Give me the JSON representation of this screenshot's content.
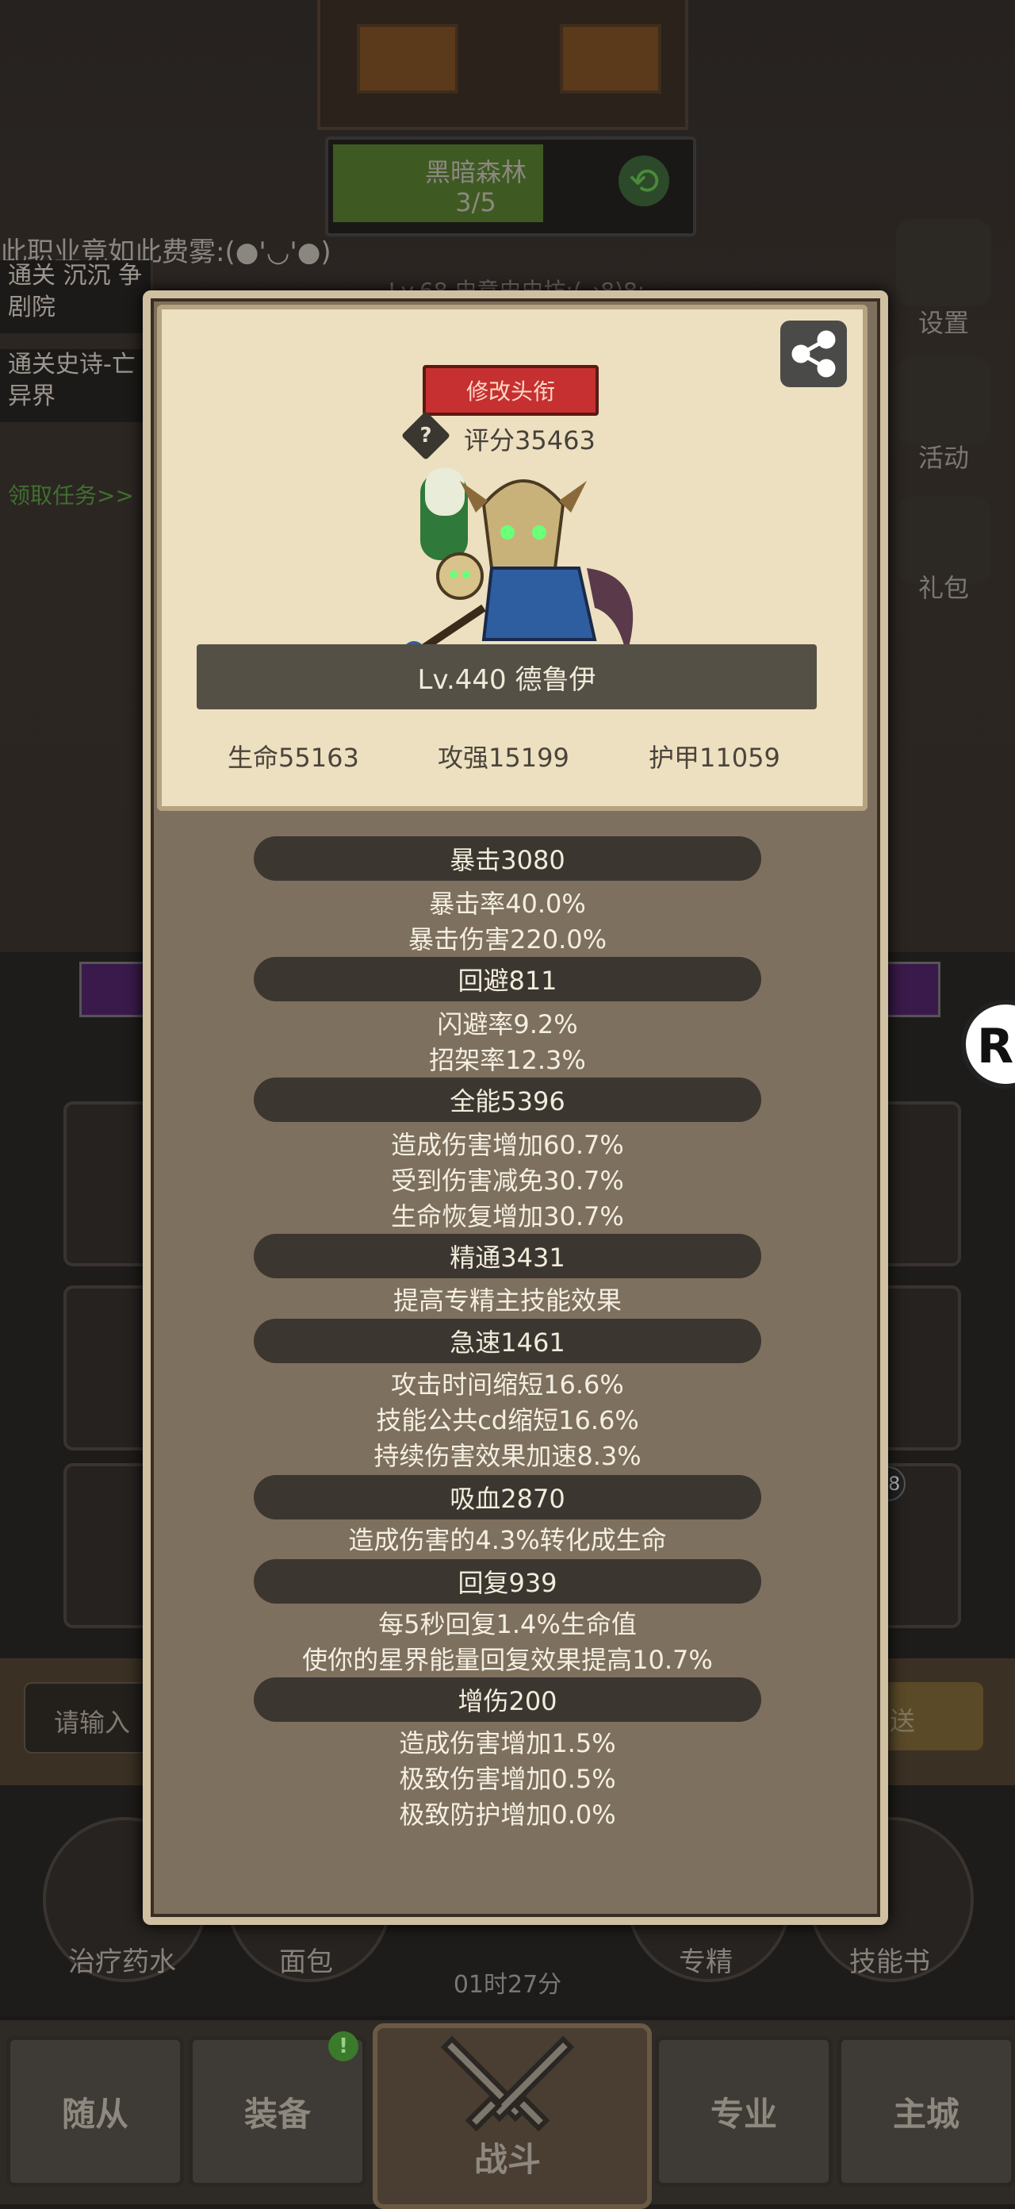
{
  "background": {
    "map": {
      "name": "黑暗森林",
      "progress": "3/5",
      "progress_fraction": 0.6
    },
    "note": "此职业竟如此费雾:(●'◡'●)",
    "level_note": "Lv.68 史意史史坊:(→8)8;",
    "quests": [
      "通关 沉沉 争剧院",
      "通关史诗-亡 异界"
    ],
    "quest_task": "领取任务>>",
    "side_menu": [
      {
        "label": "设置",
        "icon": "gear-icon"
      },
      {
        "label": "活动",
        "icon": "calendar-icon"
      },
      {
        "label": "礼包",
        "icon": "gift-icon"
      }
    ],
    "chat": {
      "placeholder": "请输入",
      "send": "发送"
    },
    "badge_count": "18",
    "items": [
      {
        "label": "治疗药水",
        "icon": "potion-icon"
      },
      {
        "label": "面包",
        "icon": "bread-icon"
      },
      {
        "label": "专精",
        "icon": "mastery-icon"
      },
      {
        "label": "技能书",
        "icon": "skill-book-icon"
      }
    ],
    "timer": "01时27分"
  },
  "nav": {
    "follower": "随从",
    "equipment": "装备",
    "battle": "战斗",
    "profession": "专业",
    "main_city": "主城",
    "equipment_badge": "!"
  },
  "character": {
    "change_title_button": "修改头衔",
    "score": "评分35463",
    "level_name": "Lv.440 德鲁伊",
    "health": "生命55163",
    "attack": "攻强15199",
    "armor": "护甲11059"
  },
  "stats": [
    {
      "header": "暴击3080",
      "lines": [
        "暴击率40.0%",
        "暴击伤害220.0%"
      ]
    },
    {
      "header": "回避811",
      "lines": [
        "闪避率9.2%",
        "招架率12.3%"
      ]
    },
    {
      "header": "全能5396",
      "lines": [
        "造成伤害增加60.7%",
        "受到伤害减免30.7%",
        "生命恢复增加30.7%"
      ]
    },
    {
      "header": "精通3431",
      "lines": [
        "提高专精主技能效果"
      ]
    },
    {
      "header": "急速1461",
      "lines": [
        "攻击时间缩短16.6%",
        "技能公共cd缩短16.6%",
        "持续伤害效果加速8.3%"
      ]
    },
    {
      "header": "吸血2870",
      "lines": [
        "造成伤害的4.3%转化成生命"
      ]
    },
    {
      "header": "回复939",
      "lines": [
        "每5秒回复1.4%生命值",
        "使你的星界能量回复效果提高10.7%"
      ]
    },
    {
      "header": "增伤200",
      "lines": [
        "造成伤害增加1.5%",
        "极致伤害增加0.5%",
        "极致防护增加0.0%"
      ]
    }
  ],
  "colors": {
    "title_button": "#c63030",
    "parchment": "#ede0c0",
    "panel": "#7e705e",
    "stat_header": "#3b3630"
  }
}
